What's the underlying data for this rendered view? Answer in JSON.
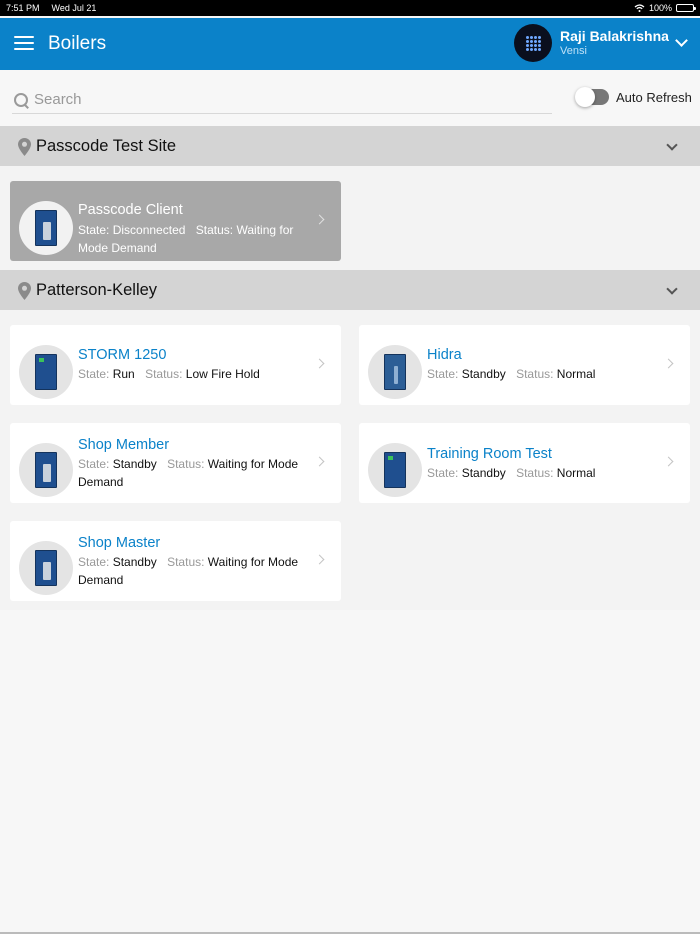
{
  "status_bar": {
    "time": "7:51 PM",
    "date": "Wed Jul 21",
    "battery": "100%"
  },
  "header": {
    "title": "Boilers",
    "user_name": "Raji Balakrishna",
    "user_org": "Vensi",
    "color": "#0b82c9"
  },
  "search": {
    "placeholder": "Search",
    "value": ""
  },
  "auto_refresh": {
    "label": "Auto Refresh",
    "enabled": false
  },
  "sites": [
    {
      "name": "Passcode Test Site",
      "boilers": [
        {
          "name": "Passcode Client",
          "state_label": "State:",
          "state": "Disconnected",
          "status_label": "Status:",
          "status": "Waiting for Mode Demand",
          "disabled": true
        }
      ]
    },
    {
      "name": "Patterson-Kelley",
      "boilers": [
        {
          "name": "STORM 1250",
          "state_label": "State:",
          "state": "Run",
          "status_label": "Status:",
          "status": "Low Fire Hold"
        },
        {
          "name": "Hidra",
          "state_label": "State:",
          "state": "Standby",
          "status_label": "Status:",
          "status": "Normal"
        },
        {
          "name": "Shop Member",
          "state_label": "State:",
          "state": "Standby",
          "status_label": "Status:",
          "status": "Waiting for Mode Demand"
        },
        {
          "name": "Training Room Test",
          "state_label": "State:",
          "state": "Standby",
          "status_label": "Status:",
          "status": "Normal"
        },
        {
          "name": "Shop Master",
          "state_label": "State:",
          "state": "Standby",
          "status_label": "Status:",
          "status": "Waiting for Mode Demand"
        }
      ]
    }
  ]
}
